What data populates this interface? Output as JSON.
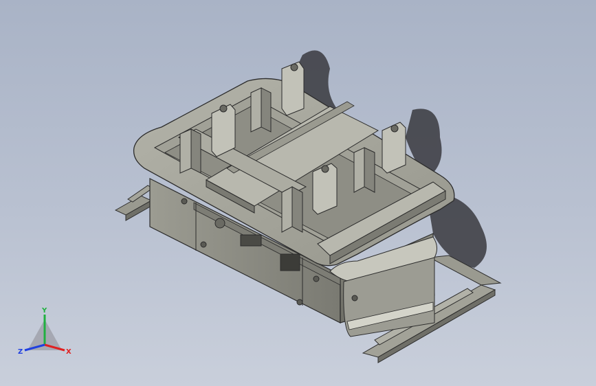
{
  "scene": {
    "background_top": "#a9b3c6",
    "background_bottom": "#c9cfdb",
    "body_color": "#8f8f86",
    "edge_color": "#2b2b2b",
    "shadow_color": "#3a3a40"
  },
  "triad": {
    "x_label": "X",
    "y_label": "Y",
    "z_label": "Z",
    "x_color": "#e02020",
    "y_color": "#20b040",
    "z_color": "#2040e0"
  }
}
